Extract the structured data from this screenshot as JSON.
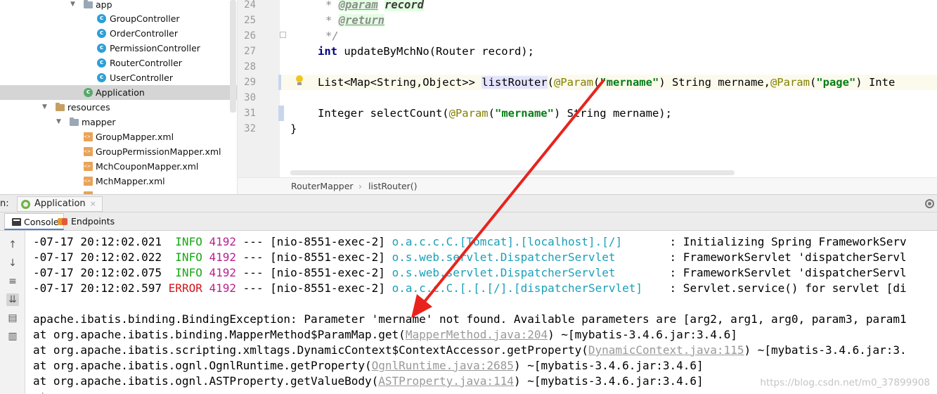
{
  "tree": {
    "items": [
      {
        "label": "app",
        "type": "folder",
        "expanded": true
      },
      {
        "label": "GroupController",
        "type": "class"
      },
      {
        "label": "OrderController",
        "type": "class"
      },
      {
        "label": "PermissionController",
        "type": "class"
      },
      {
        "label": "RouterController",
        "type": "class"
      },
      {
        "label": "UserController",
        "type": "class"
      },
      {
        "label": "Application",
        "type": "spring-class",
        "selected": true
      },
      {
        "label": "resources",
        "type": "resource-folder",
        "expanded": true
      },
      {
        "label": "mapper",
        "type": "folder",
        "expanded": true
      },
      {
        "label": "GroupMapper.xml",
        "type": "xml"
      },
      {
        "label": "GroupPermissionMapper.xml",
        "type": "xml"
      },
      {
        "label": "MchCouponMapper.xml",
        "type": "xml"
      },
      {
        "label": "MchMapper.xml",
        "type": "xml"
      }
    ]
  },
  "editor": {
    "line_numbers": [
      "24",
      "25",
      "26",
      "27",
      "28",
      "29",
      "30",
      "31",
      "32"
    ],
    "lines": {
      "l24": {
        "star": "* ",
        "tag": "@param",
        "param": "record"
      },
      "l25": {
        "star": "* ",
        "tag": "@return"
      },
      "l26": {
        "end": "*/"
      },
      "l27": {
        "kw": "int",
        "rest": " updateByMchNo(Router record);"
      },
      "l29": {
        "a": "List<Map<String,Object>> ",
        "method": "listRouter",
        "b": "(",
        "anno1": "@Param",
        "c": "(",
        "str1": "\"mername\"",
        "d": ") String mername,",
        "anno2": "@Param",
        "e": "(",
        "str2": "\"page\"",
        "f": ") Inte"
      },
      "l31": {
        "a": "Integer selectCount(",
        "anno": "@Param",
        "b": "(",
        "str": "\"mername\"",
        "c": ") String mername);"
      },
      "l32": {
        "a": "}"
      }
    }
  },
  "breadcrumb": {
    "class": "RouterMapper",
    "separator": "›",
    "method": "listRouter()"
  },
  "run": {
    "prefix": "n:",
    "tab_label": "Application",
    "close": "×"
  },
  "console_tabs": {
    "console": "Console",
    "endpoints": "Endpoints"
  },
  "console": {
    "log_lines": [
      {
        "time": "-07-17 20:12:02.021",
        "level": "INFO",
        "pid": "4192",
        "sep": " --- ",
        "thread": "[nio-8551-exec-2]",
        "logger": "o.a.c.c.C.[Tomcat].[localhost].[/]      ",
        "msg": " : Initializing Spring FrameworkServ"
      },
      {
        "time": "-07-17 20:12:02.022",
        "level": "INFO",
        "pid": "4192",
        "sep": " --- ",
        "thread": "[nio-8551-exec-2]",
        "logger": "o.s.web.servlet.DispatcherServlet       ",
        "msg": " : FrameworkServlet 'dispatcherServl"
      },
      {
        "time": "-07-17 20:12:02.075",
        "level": "INFO",
        "pid": "4192",
        "sep": " --- ",
        "thread": "[nio-8551-exec-2]",
        "logger": "o.s.web.servlet.DispatcherServlet       ",
        "msg": " : FrameworkServlet 'dispatcherServl"
      },
      {
        "time": "-07-17 20:12:02.597",
        "level": "ERROR",
        "pid": "4192",
        "sep": " --- ",
        "thread": "[nio-8551-exec-2]",
        "logger": "o.a.c.c.C.[.[.[/].[dispatcherServlet]   ",
        "msg": " : Servlet.service() for servlet [di"
      }
    ],
    "exception": "apache.ibatis.binding.BindingException: Parameter 'mername' not found. Available parameters are [arg2, arg1, arg0, param3, param1",
    "stack": [
      {
        "pre": "at org.apache.ibatis.binding.MapperMethod$ParamMap.get(",
        "link": "MapperMethod.java:204",
        "post": ") ~[mybatis-3.4.6.jar:3.4.6]"
      },
      {
        "pre": "at org.apache.ibatis.scripting.xmltags.DynamicContext$ContextAccessor.getProperty(",
        "link": "DynamicContext.java:115",
        "post": ") ~[mybatis-3.4.6.jar:3."
      },
      {
        "pre": "at org.apache.ibatis.ognl.OgnlRuntime.getProperty(",
        "link": "OgnlRuntime.java:2685",
        "post": ") ~[mybatis-3.4.6.jar:3.4.6]"
      },
      {
        "pre": "at org.apache.ibatis.ognl.ASTProperty.getValueBody(",
        "link": "ASTProperty.java:114",
        "post": ") ~[mybatis-3.4.6.jar:3.4.6]"
      }
    ],
    "watermark": "https://blog.csdn.net/m0_37899908"
  },
  "colors": {
    "info": "#17a814",
    "error": "#d4151a",
    "pid": "#b8218d",
    "logger": "#1a9fb8",
    "annotation_arrow": "#e8231d"
  },
  "icons": [
    "folder-icon",
    "class-icon",
    "xml-file-icon",
    "spring-icon",
    "console-icon",
    "endpoints-icon",
    "gear-icon",
    "lightbulb-icon",
    "up-arrow-icon",
    "down-arrow-icon",
    "soft-wrap-icon",
    "scroll-to-end-icon",
    "print-icon",
    "trash-icon"
  ]
}
